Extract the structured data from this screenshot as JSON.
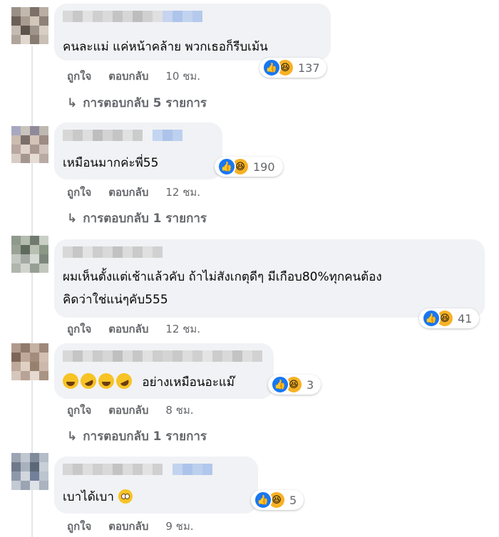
{
  "colors": {
    "bubble": "#f0f2f5",
    "meta_text": "#65676b",
    "like_blue": "#1877f2",
    "haha_yellow": "#f7b125"
  },
  "comments": [
    {
      "text_lines": [
        "คนละแม่ แค่หน้าคล้าย พวกเธอก็รีบเม้น"
      ],
      "reaction_count": "137",
      "like_label": "ถูกใจ",
      "reply_label": "ตอบกลับ",
      "time": "10 ชม.",
      "replies_label": "การตอบกลับ 5 รายการ"
    },
    {
      "text_lines": [
        "เหมือนมากค่ะพี่55"
      ],
      "reaction_count": "190",
      "like_label": "ถูกใจ",
      "reply_label": "ตอบกลับ",
      "time": "12 ชม.",
      "replies_label": "การตอบกลับ 1 รายการ"
    },
    {
      "text_lines": [
        "ผมเห็นตั้งแต่เช้าแล้วคับ ถ้าไม่สังเกตุดีๆ มีเกือบ80%ทุกคนต้อง",
        "คิดว่าใช่แน่ๆคับ555"
      ],
      "reaction_count": "41",
      "like_label": "ถูกใจ",
      "reply_label": "ตอบกลับ",
      "time": "12 ชม."
    },
    {
      "text_lines": [
        "อย่างเหมือนอะแม๊"
      ],
      "reaction_count": "3",
      "like_label": "ถูกใจ",
      "reply_label": "ตอบกลับ",
      "time": "8 ชม.",
      "replies_label": "การตอบกลับ 1 รายการ"
    },
    {
      "text_lines": [
        "เบาได้เบา"
      ],
      "reaction_count": "5",
      "like_label": "ถูกใจ",
      "reply_label": "ตอบกลับ",
      "time": "9 ชม."
    }
  ],
  "icons": {
    "reply_arrow": "↳",
    "like": "👍",
    "haha": "😆"
  }
}
